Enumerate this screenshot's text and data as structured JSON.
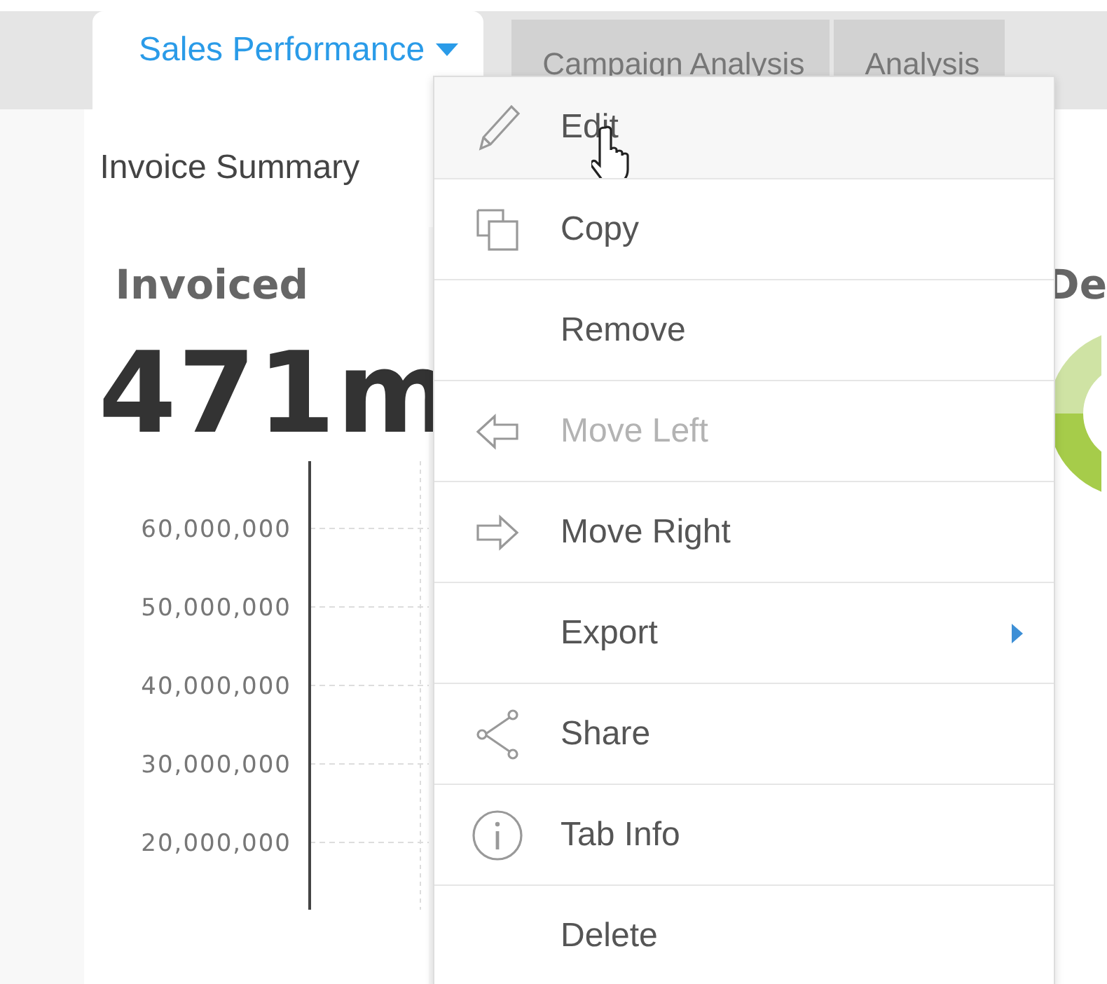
{
  "tabs": [
    {
      "label": "Sales Performance",
      "selected": true,
      "has_menu": true
    },
    {
      "label": "Campaign Analysis",
      "selected": false,
      "has_menu": false
    },
    {
      "label": "Analysis",
      "selected": false,
      "has_menu": false
    }
  ],
  "section_title": "Invoice Summary",
  "invoiced_card": {
    "title": "Invoiced",
    "value": "471m",
    "axis_labels": [
      "60,000,000",
      "50,000,000",
      "40,000,000",
      "30,000,000",
      "20,000,000"
    ]
  },
  "second_card": {
    "title": "De"
  },
  "tab_menu": [
    {
      "label": "Edit",
      "kind": "edit",
      "hovered": true,
      "disabled": false
    },
    {
      "label": "Copy",
      "kind": "copy",
      "hovered": false,
      "disabled": false
    },
    {
      "label": "Remove",
      "kind": "plain",
      "hovered": false,
      "disabled": false
    },
    {
      "label": "Move Left",
      "kind": "left",
      "hovered": false,
      "disabled": true
    },
    {
      "label": "Move Right",
      "kind": "right",
      "hovered": false,
      "disabled": false
    },
    {
      "label": "Export",
      "kind": "submenu",
      "hovered": false,
      "disabled": false
    },
    {
      "label": "Share",
      "kind": "share",
      "hovered": false,
      "disabled": false
    },
    {
      "label": "Tab Info",
      "kind": "info",
      "hovered": false,
      "disabled": false
    },
    {
      "label": "Delete",
      "kind": "plain",
      "hovered": false,
      "disabled": false
    }
  ]
}
